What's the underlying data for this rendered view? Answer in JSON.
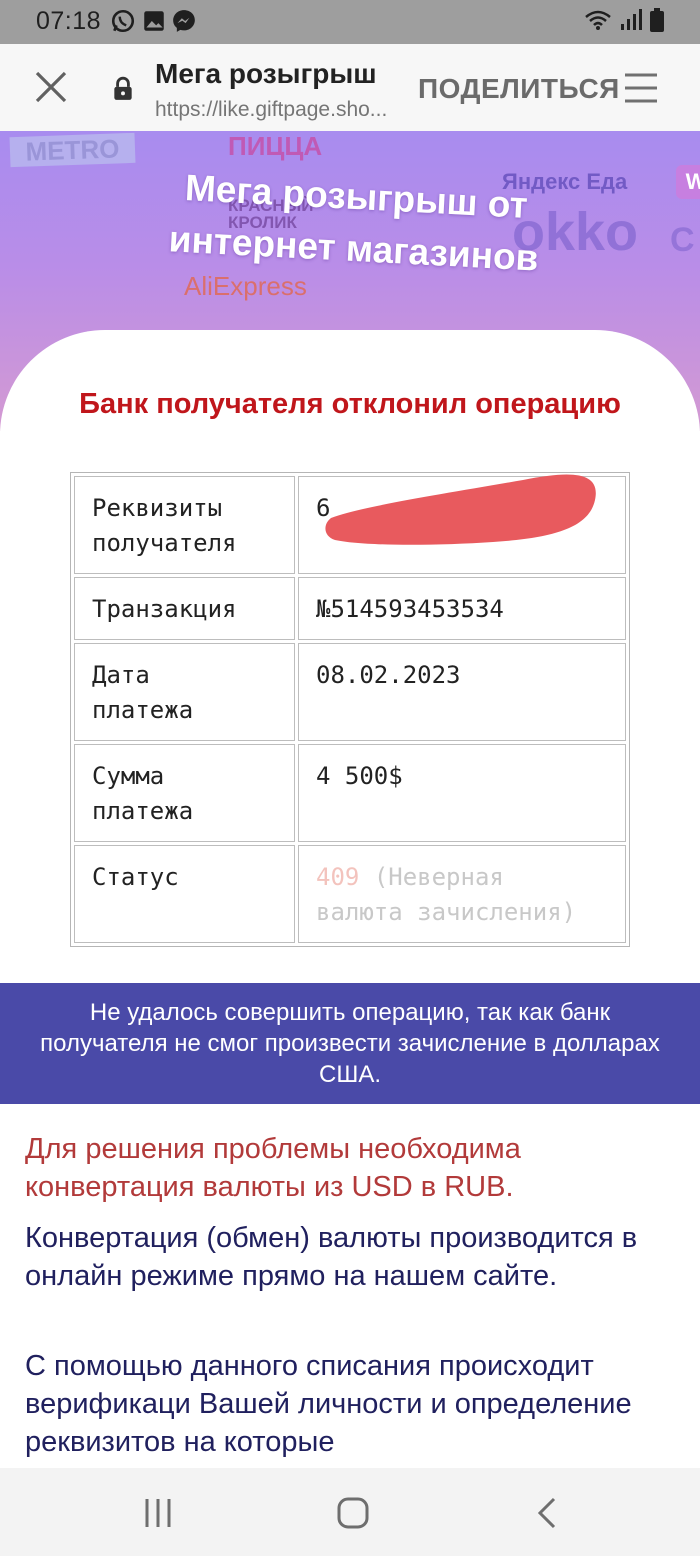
{
  "status_bar": {
    "time": "07:18",
    "left_icons": [
      "whatsapp-icon",
      "gallery-icon",
      "messenger-icon"
    ],
    "right_icons": [
      "wifi-icon",
      "signal-icon",
      "battery-icon"
    ]
  },
  "browser": {
    "title": "Мега розыгрыш",
    "url": "https://like.giftpage.sho...",
    "share_label": "ПОДЕЛИТЬСЯ"
  },
  "hero": {
    "title_line1": "Мега розыгрыш от",
    "title_line2": "интернет магазинов",
    "logos": {
      "metro": "METRO",
      "pizza": "ПИЦЦА",
      "yandex": "Яндекс Еда",
      "w": "W",
      "krolik_1": "КРАСНЫЙ",
      "krolik_2": "КРОЛИК",
      "okko": "okko",
      "c": "C",
      "aliexpress": "AliExpress"
    }
  },
  "card": {
    "title": "Банк получателя отклонил операцию",
    "rows": [
      {
        "label_1": "Реквизиты",
        "label_2": "получателя",
        "value": "6"
      },
      {
        "label_1": "Транзакция",
        "label_2": "",
        "value": "№514593453534"
      },
      {
        "label_1": "Дата",
        "label_2": "платежа",
        "value": "08.02.2023"
      },
      {
        "label_1": "Сумма",
        "label_2": "платежа",
        "value": "4 500$"
      },
      {
        "label_1": "Статус",
        "label_2": "",
        "status_code": "409",
        "status_text_1": "(Неверная",
        "status_text_2": "валюта зачисления)"
      }
    ]
  },
  "notice": {
    "line1": "Не удалось совершить операцию, так как банк",
    "line2": "получателя не смог произвести зачисление в долларах",
    "line3": "США."
  },
  "paragraphs": {
    "p1": "Для решения проблемы необходима конвертация валюты из USD в RUB.",
    "p2": "Конвертация (обмен) валюты производится в онлайн режиме прямо на нашем сайте.",
    "p3": "С помощью данного списания происходит верификаци Вашей личности и определение реквизитов на которые"
  },
  "colors": {
    "status_bar": "#9e9e9e",
    "card_title": "#c0161b",
    "notice_bg": "#4a4aa8",
    "p1_text": "#b23a3a",
    "p_text": "#20205e",
    "redaction": "#e85a5e"
  },
  "nav": [
    "recents-icon",
    "home-icon",
    "back-icon"
  ]
}
